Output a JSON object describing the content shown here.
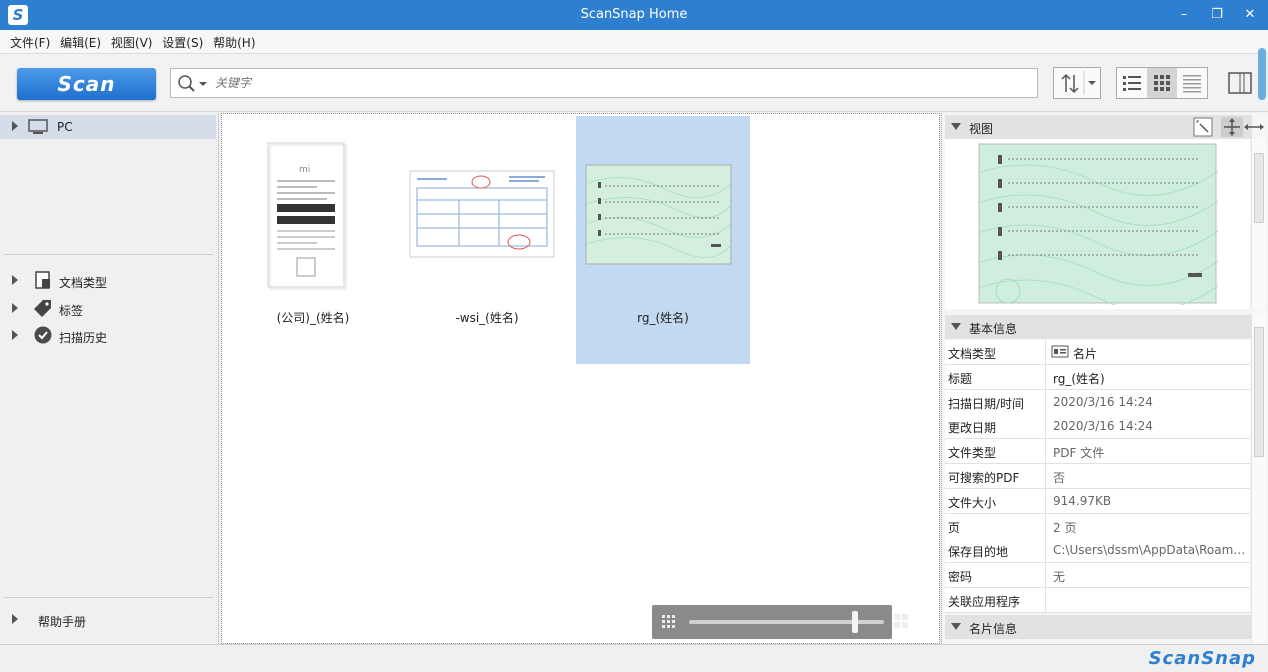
{
  "app": {
    "title": "ScanSnap Home",
    "brand": "ScanSnap"
  },
  "window_controls": {
    "minimize": "–",
    "restore": "❐",
    "close": "✕"
  },
  "menu": [
    "文件(F)",
    "编辑(E)",
    "视图(V)",
    "设置(S)",
    "帮助(H)"
  ],
  "toolbar": {
    "scan_label": "Scan",
    "search_placeholder": "关键字"
  },
  "sidebar": {
    "pc_label": "PC",
    "items": [
      {
        "label": "文档类型",
        "icon": "doc-type-icon"
      },
      {
        "label": "标签",
        "icon": "tag-icon"
      },
      {
        "label": "扫描历史",
        "icon": "history-check-icon"
      }
    ],
    "help_label": "帮助手册"
  },
  "thumbnails": [
    {
      "caption": "(公司)_(姓名)",
      "selected": false
    },
    {
      "caption": "-wsi_(姓名)",
      "selected": false
    },
    {
      "caption": "rg_(姓名)",
      "selected": true
    }
  ],
  "zoom": {
    "level": 0.85
  },
  "right_panel": {
    "view_header": "视图",
    "info_header": "基本信息",
    "card_header": "名片信息",
    "properties": [
      {
        "key": "文档类型",
        "value": "名片",
        "icon": "card-icon"
      },
      {
        "key": "标题",
        "value": "rg_(姓名)"
      },
      {
        "key": "扫描日期/时间",
        "value": "2020/3/16 14:24"
      },
      {
        "key": "更改日期",
        "value": "2020/3/16 14:24"
      },
      {
        "key": "文件类型",
        "value": "PDF 文件"
      },
      {
        "key": "可搜索的PDF",
        "value": "否"
      },
      {
        "key": "文件大小",
        "value": "914.97KB"
      },
      {
        "key": "页",
        "value": "2 页"
      },
      {
        "key": "保存目的地",
        "value": "C:\\Users\\dssm\\AppData\\Roaming\\ScanSnap"
      },
      {
        "key": "密码",
        "value": "无"
      },
      {
        "key": "关联应用程序",
        "value": ""
      }
    ]
  },
  "colors": {
    "accent": "#2f7fd0",
    "selection": "#c2d9f2",
    "card_green": "#cfeedd"
  }
}
